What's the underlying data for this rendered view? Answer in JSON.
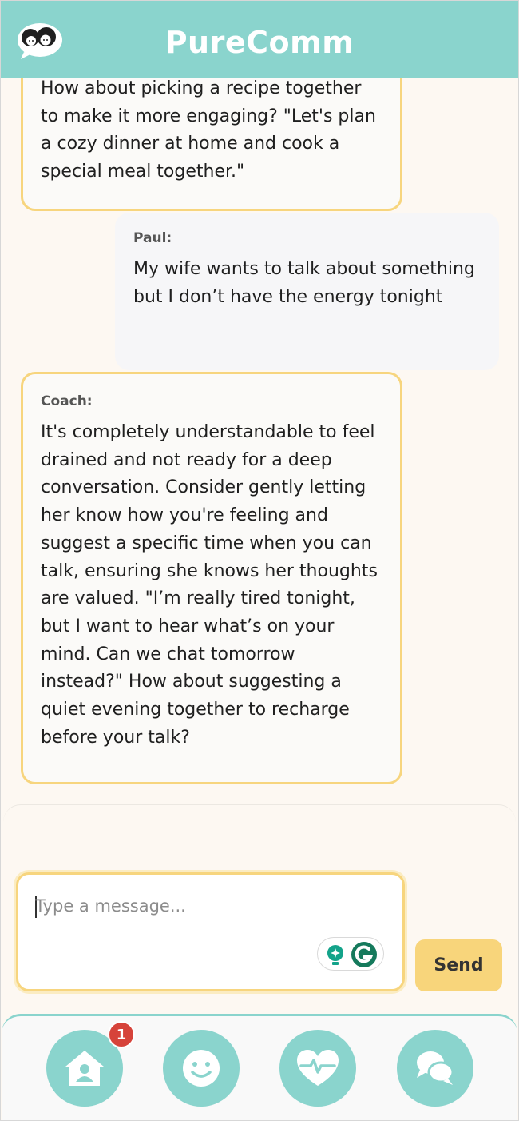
{
  "header": {
    "title": "PureComm"
  },
  "messages": [
    {
      "sender": "Coach",
      "sender_label": "",
      "text": "How about picking a recipe together to make it more engaging? \"Let's plan a cozy dinner at home and cook a special meal together.\""
    },
    {
      "sender": "Paul",
      "sender_label": "Paul:",
      "text": "My wife wants to talk about something but I don’t have the energy tonight"
    },
    {
      "sender": "Coach",
      "sender_label": "Coach:",
      "text": "It's completely understandable to feel drained and not ready for a deep conversation. Consider gently letting her know how you're feeling and suggest a specific time when you can talk, ensuring she knows her thoughts are valued. \"I’m really tired tonight, but I want to hear what’s on your mind. Can we chat tomorrow instead?\" How about suggesting a quiet evening together to recharge before your talk?"
    }
  ],
  "composer": {
    "placeholder": "Type a message...",
    "send_label": "Send"
  },
  "nav": {
    "items": [
      {
        "icon": "home-icon",
        "badge": "1"
      },
      {
        "icon": "smiley-icon"
      },
      {
        "icon": "heartbeat-icon"
      },
      {
        "icon": "chat-bubbles-icon"
      }
    ]
  },
  "colors": {
    "header": "#8ad4cd",
    "coach_border": "#f7d57e",
    "send_button": "#f8d57b",
    "badge": "#d6433a"
  }
}
